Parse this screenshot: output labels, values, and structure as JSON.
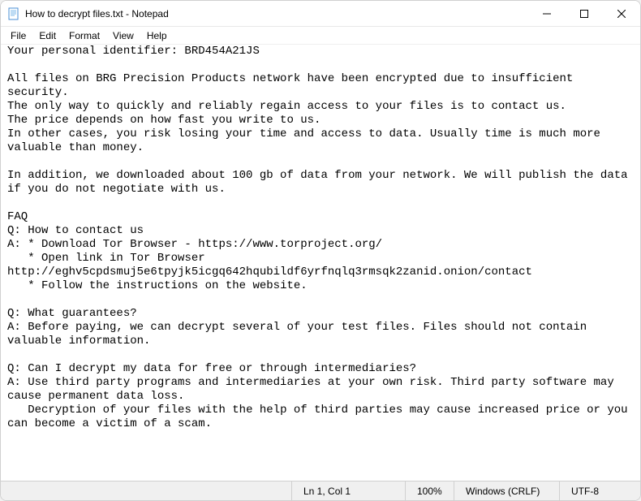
{
  "titlebar": {
    "title": "How to decrypt files.txt - Notepad"
  },
  "menu": {
    "file": "File",
    "edit": "Edit",
    "format": "Format",
    "view": "View",
    "help": "Help"
  },
  "content": {
    "text": "Your personal identifier: BRD454A21JS\n\nAll files on BRG Precision Products network have been encrypted due to insufficient security.\nThe only way to quickly and reliably regain access to your files is to contact us.\nThe price depends on how fast you write to us.\nIn other cases, you risk losing your time and access to data. Usually time is much more valuable than money.\n\nIn addition, we downloaded about 100 gb of data from your network. We will publish the data if you do not negotiate with us.\n\nFAQ\nQ: How to contact us\nA: * Download Tor Browser - https://www.torproject.org/\n   * Open link in Tor Browser\nhttp://eghv5cpdsmuj5e6tpyjk5icgq642hqubildf6yrfnqlq3rmsqk2zanid.onion/contact\n   * Follow the instructions on the website.\n\nQ: What guarantees?\nA: Before paying, we can decrypt several of your test files. Files should not contain valuable information.\n\nQ: Can I decrypt my data for free or through intermediaries?\nA: Use third party programs and intermediaries at your own risk. Third party software may cause permanent data loss.\n   Decryption of your files with the help of third parties may cause increased price or you can become a victim of a scam."
  },
  "statusbar": {
    "position": "Ln 1, Col 1",
    "zoom": "100%",
    "lineending": "Windows (CRLF)",
    "encoding": "UTF-8"
  }
}
